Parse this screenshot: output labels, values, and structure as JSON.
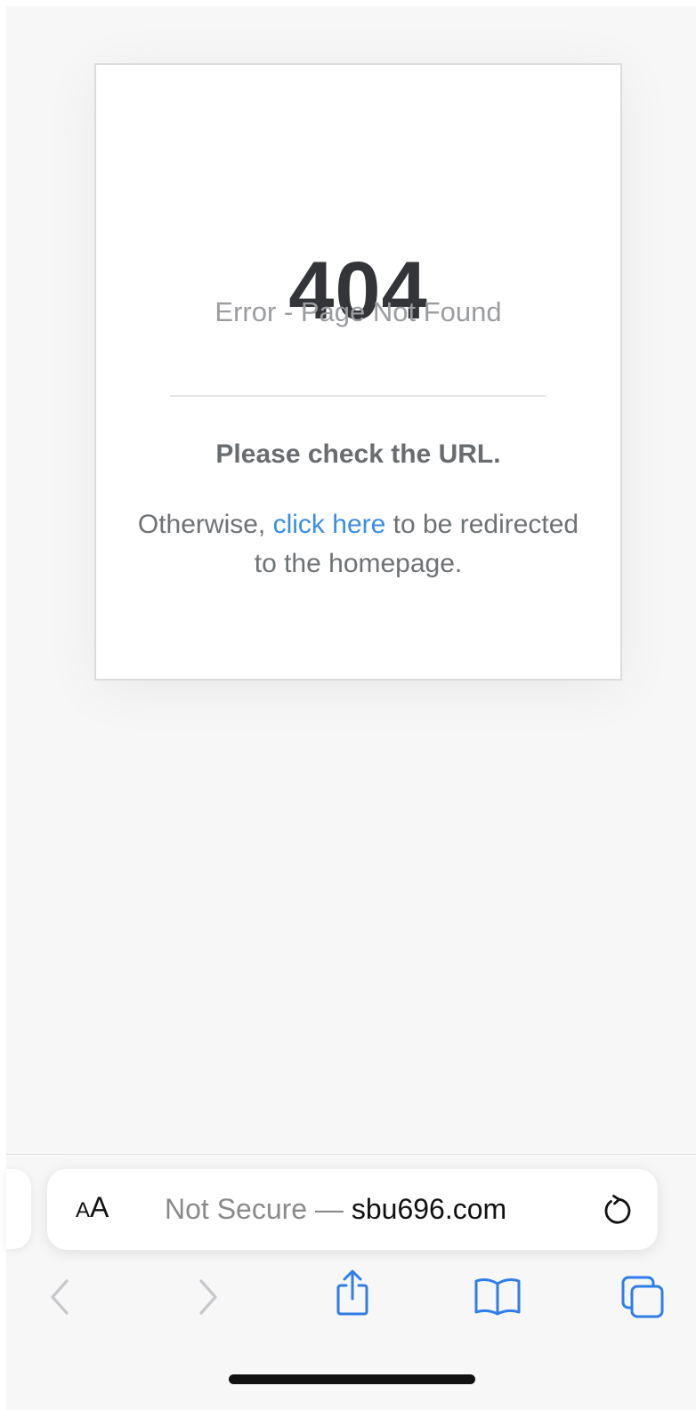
{
  "error_card": {
    "code": "404",
    "subtitle": "Error - Page Not Found",
    "check_message": "Please check the URL.",
    "redirect_prefix": "Otherwise, ",
    "redirect_link": "click here",
    "redirect_suffix": " to be redirected to the homepage."
  },
  "address_bar": {
    "text_size_label_small": "A",
    "text_size_label_large": "A",
    "security_status": "Not Secure — ",
    "domain": "sbu696.com",
    "reload_icon": "reload-icon"
  },
  "toolbar": {
    "back_icon": "chevron-left-icon",
    "forward_icon": "chevron-right-icon",
    "share_icon": "share-icon",
    "bookmarks_icon": "book-icon",
    "tabs_icon": "tabs-icon"
  },
  "colors": {
    "accent": "#3a8ee6",
    "disabled": "#c7c7cc",
    "page_background": "#f7f7f7"
  }
}
